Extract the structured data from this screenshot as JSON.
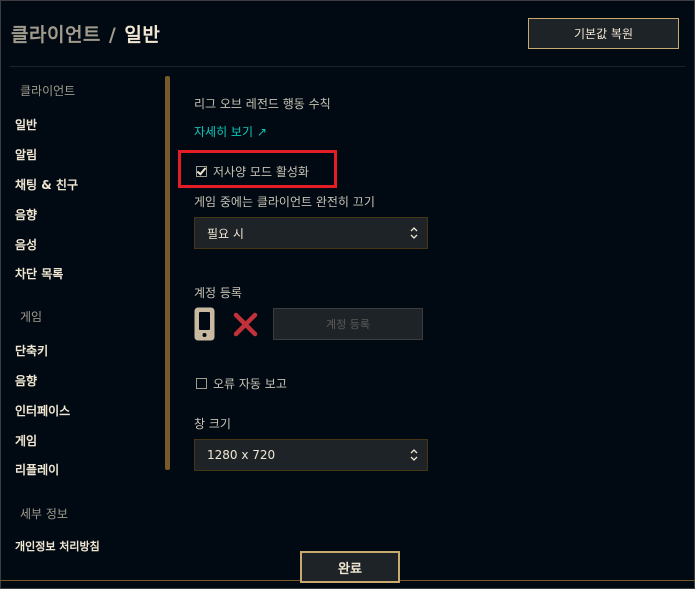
{
  "header": {
    "breadcrumb_parent": "클라이언트",
    "breadcrumb_separator": "/",
    "breadcrumb_current": "일반",
    "restore_button": "기본값 복원"
  },
  "sidebar": {
    "sections": [
      {
        "title": "클라이언트",
        "items": [
          "일반",
          "알림",
          "채팅 & 친구",
          "음향",
          "음성",
          "차단 목록"
        ]
      },
      {
        "title": "게임",
        "items": [
          "단축키",
          "음향",
          "인터페이스",
          "게임",
          "리플레이"
        ]
      },
      {
        "title": "세부 정보",
        "items": [
          "개인정보 처리방침"
        ]
      }
    ]
  },
  "main": {
    "code_of_conduct_label": "리그 오브 레전드 행동 수칙",
    "learn_more_link": "자세히 보기 ↗",
    "low_spec_mode": {
      "label": "저사양 모드 활성화",
      "checked": true
    },
    "close_client_label": "게임 중에는 클라이언트 완전히 끄기",
    "close_client_value": "필요 시",
    "account_register_label": "계정 등록",
    "account_register_button": "계정 등록",
    "error_report": {
      "label": "오류 자동 보고",
      "checked": false
    },
    "window_size_label": "창 크기",
    "window_size_value": "1280 x 720"
  },
  "footer": {
    "done_button": "완료"
  },
  "colors": {
    "background": "#010a13",
    "gold": "#c8aa6e",
    "highlight": "#e31c25",
    "link": "#0ac8b9"
  }
}
